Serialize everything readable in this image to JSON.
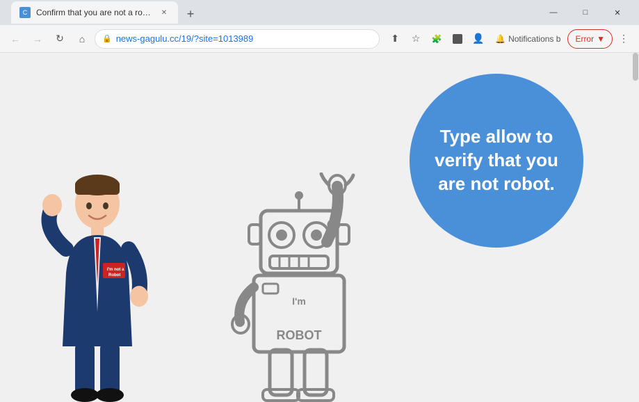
{
  "browser": {
    "title_bar": {
      "window_controls": {
        "minimize": "—",
        "maximize": "□",
        "close": "✕"
      }
    },
    "tab": {
      "favicon_text": "C",
      "title": "Confirm that you are not a robot",
      "close": "✕"
    },
    "new_tab_button": "+",
    "toolbar": {
      "back_btn": "←",
      "forward_btn": "→",
      "reload_btn": "↻",
      "home_btn": "⌂",
      "address": "news-gagulu.cc/19/?site=1013989",
      "notifications_label": "Notifications b",
      "error_label": "Error",
      "share_icon": "⬆",
      "bookmark_icon": "☆",
      "extension_icon_1": "🧩",
      "extension_icon_2": "⬛",
      "profile_icon": "👤",
      "menu_icon": "⋮"
    }
  },
  "page": {
    "circle_text": "Type allow to verify that you are not robot.",
    "page_bg": "#f0f0f0"
  }
}
